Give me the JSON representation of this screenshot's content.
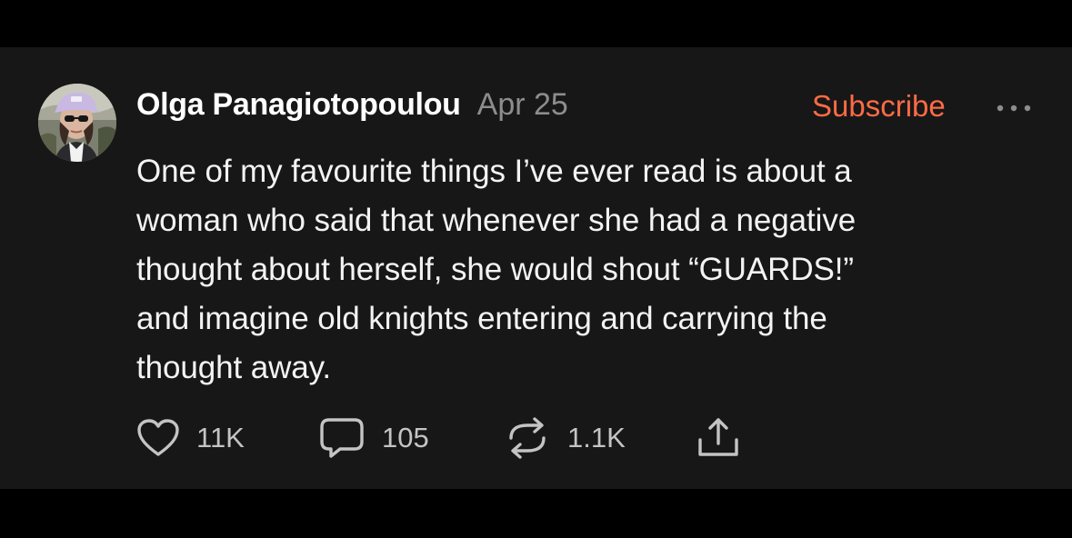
{
  "post": {
    "author": "Olga Panagiotopoulou",
    "date": "Apr 25",
    "subscribe_label": "Subscribe",
    "body_lines": [
      "One of my favourite things I’ve ever read is about a",
      "woman who said that whenever she had a negative",
      "thought about herself, she would shout “GUARDS!”",
      "and imagine old knights entering and carrying the",
      "thought away."
    ]
  },
  "actions": {
    "like_count": "11K",
    "comment_count": "105",
    "restack_count": "1.1K"
  },
  "icons": {
    "like": "heart-icon",
    "comment": "comment-bubble-icon",
    "restack": "restack-arrows-icon",
    "share": "share-upload-icon",
    "more": "more-dots-icon"
  },
  "colors": {
    "background": "#171717",
    "accent": "#ff6b45",
    "author_text": "#ffffff",
    "muted_text": "#8d8d8d"
  }
}
